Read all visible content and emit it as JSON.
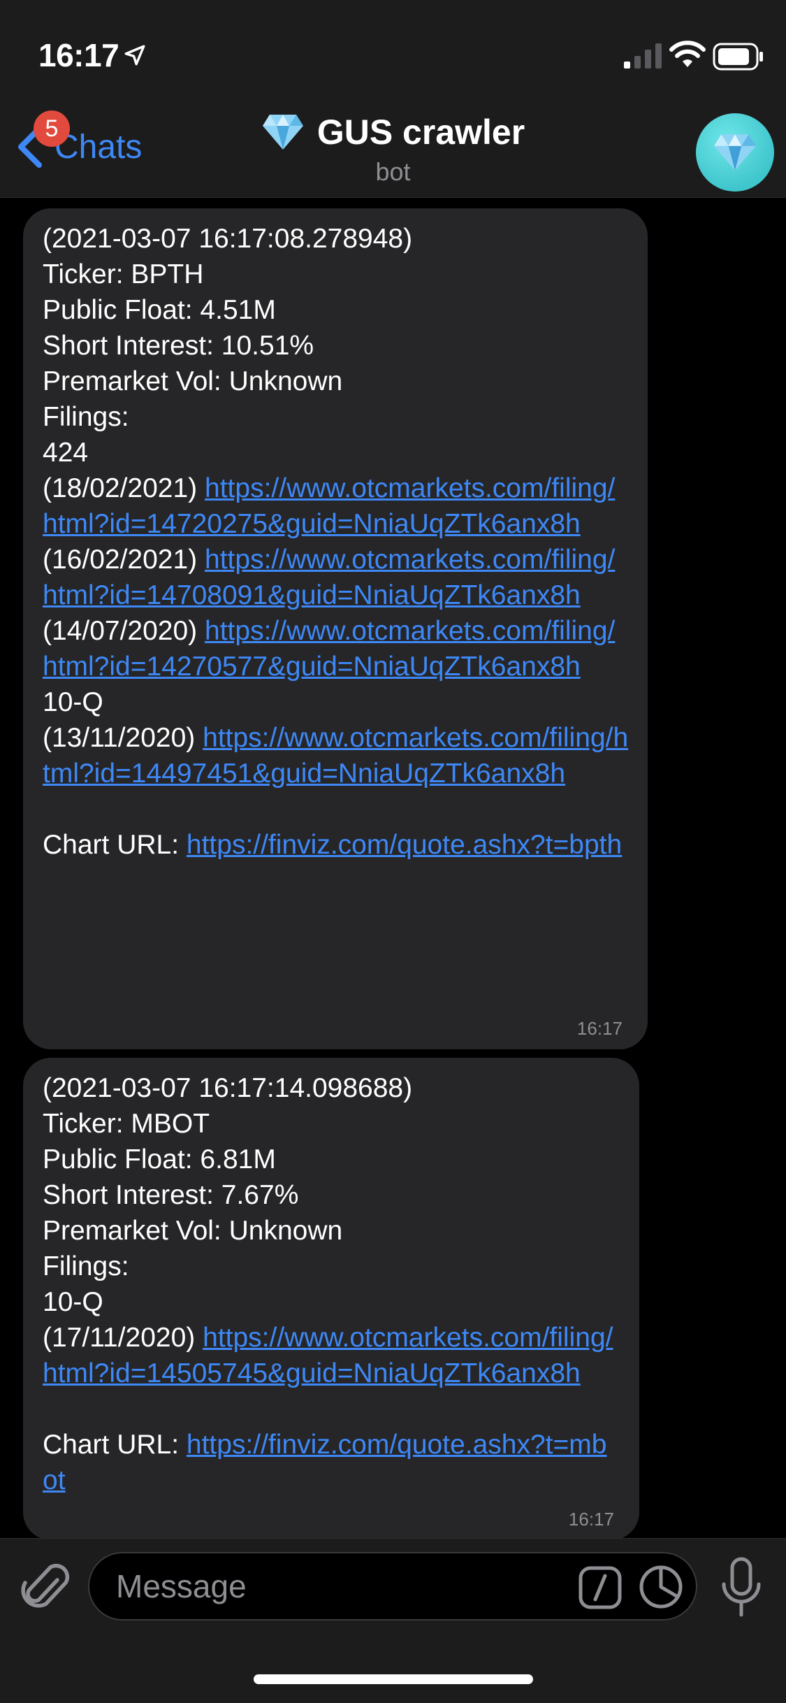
{
  "status_bar": {
    "time": "16:17"
  },
  "nav": {
    "back_label": "Chats",
    "unread_count": "5",
    "title": "GUS crawler",
    "subtitle": "bot"
  },
  "messages": [
    {
      "timestamp_line": "(2021-03-07 16:17:08.278948)",
      "ticker": "Ticker: BPTH",
      "public_float": "Public Float: 4.51M",
      "short_interest": "Short Interest: 10.51%",
      "premarket_vol": "Premarket Vol: Unknown",
      "filings_label": "Filings:",
      "groups": [
        {
          "form": "424",
          "filings": [
            {
              "date": "(18/02/2021)",
              "url": "https://www.otcmarkets.com/filing/html?id=14720275&guid=NniaUqZTk6anx8h"
            },
            {
              "date": "(16/02/2021)",
              "url": "https://www.otcmarkets.com/filing/html?id=14708091&guid=NniaUqZTk6anx8h"
            },
            {
              "date": "(14/07/2020)",
              "url": "https://www.otcmarkets.com/filing/html?id=14270577&guid=NniaUqZTk6anx8h"
            }
          ]
        },
        {
          "form": "10-Q",
          "filings": [
            {
              "date": "(13/11/2020)",
              "url": "https://www.otcmarkets.com/filing/html?id=14497451&guid=NniaUqZTk6anx8h"
            }
          ]
        }
      ],
      "chart_label": "Chart URL:",
      "chart_url": "https://finviz.com/quote.ashx?t=bpth",
      "time": "16:17"
    },
    {
      "timestamp_line": "(2021-03-07 16:17:14.098688)",
      "ticker": "Ticker: MBOT",
      "public_float": "Public Float: 6.81M",
      "short_interest": "Short Interest: 7.67%",
      "premarket_vol": "Premarket Vol: Unknown",
      "filings_label": "Filings:",
      "groups": [
        {
          "form": "10-Q",
          "filings": [
            {
              "date": "(17/11/2020)",
              "url": "https://www.otcmarkets.com/filing/html?id=14505745&guid=NniaUqZTk6anx8h"
            }
          ]
        }
      ],
      "chart_label": "Chart URL:",
      "chart_url": "https://finviz.com/quote.ashx?t=mbot",
      "time": "16:17"
    }
  ],
  "composer": {
    "placeholder": "Message"
  },
  "colors": {
    "accent": "#3e88f6",
    "badge": "#e14a3d",
    "bubble": "#262628",
    "bar": "#1c1c1d"
  }
}
